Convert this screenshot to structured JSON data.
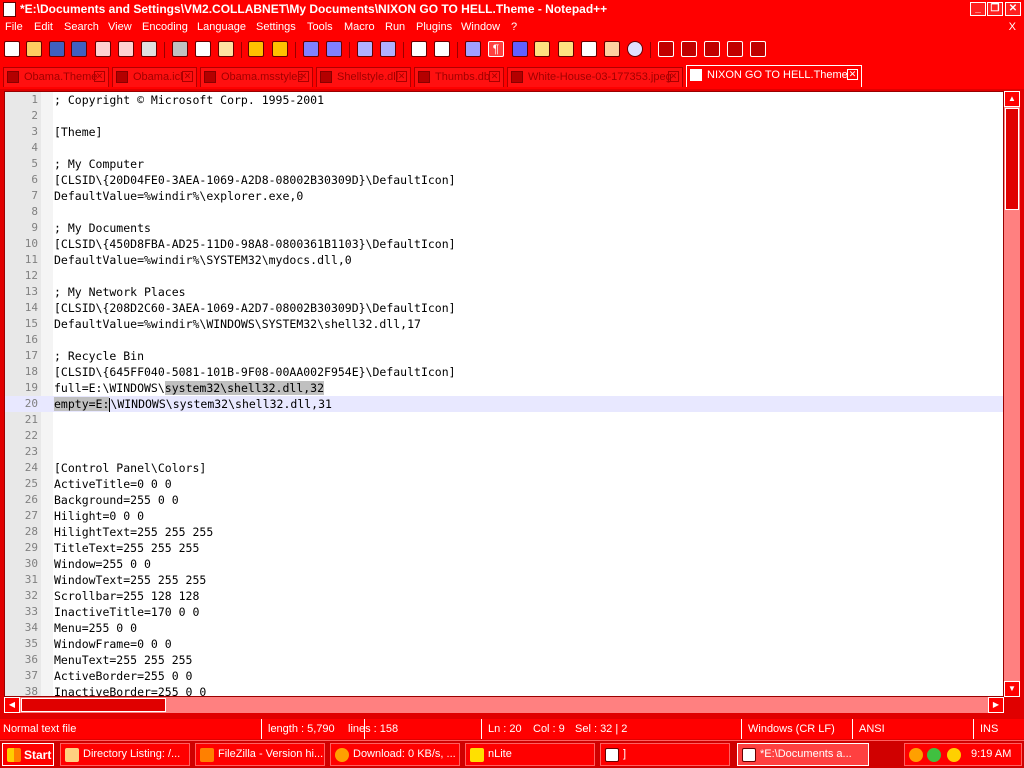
{
  "window": {
    "title": "*E:\\Documents and Settings\\VM2.COLLABNET\\My Documents\\NIXON GO TO HELL.Theme - Notepad++",
    "minimize": "_",
    "maximize": "❐",
    "close": "✕"
  },
  "menu": {
    "items": [
      "File",
      "Edit",
      "Search",
      "View",
      "Encoding",
      "Language",
      "Settings",
      "Tools",
      "Macro",
      "Run",
      "Plugins",
      "Window",
      "?"
    ],
    "close_doc": "X"
  },
  "toolbar": {
    "icons": [
      "new-icon",
      "open-icon",
      "save-icon",
      "save-all-icon",
      "close-icon",
      "close-all-icon",
      "print-icon",
      "cut-icon",
      "copy-icon",
      "paste-icon",
      "undo-icon",
      "redo-icon",
      "find-icon",
      "replace-icon",
      "zoom-in-icon",
      "zoom-out-icon",
      "sync-v-icon",
      "sync-h-icon",
      "wrap-icon",
      "all-chars-icon",
      "indent-guide-icon",
      "udl-icon",
      "doc-map-icon",
      "func-list-icon",
      "folder-icon",
      "monitor-icon",
      "record-icon",
      "stop-icon",
      "play-icon",
      "run-multi-icon",
      "save-macro-icon"
    ]
  },
  "tabs": [
    {
      "label": "Obama.Theme",
      "active": false
    },
    {
      "label": "Obama.icl",
      "active": false
    },
    {
      "label": "Obama.msstyles",
      "active": false
    },
    {
      "label": "Shellstyle.dll",
      "active": false
    },
    {
      "label": "Thumbs.db",
      "active": false
    },
    {
      "label": "White-House-03-177353.jpeg",
      "active": false
    },
    {
      "label": "NIXON GO TO HELL.Theme",
      "active": true
    }
  ],
  "editor": {
    "current_line": 20,
    "lines": [
      "; Copyright © Microsoft Corp. 1995-2001",
      "",
      "[Theme]",
      "",
      "; My Computer",
      "[CLSID\\{20D04FE0-3AEA-1069-A2D8-08002B30309D}\\DefaultIcon]",
      "DefaultValue=%windir%\\explorer.exe,0",
      "",
      "; My Documents",
      "[CLSID\\{450D8FBA-AD25-11D0-98A8-0800361B1103}\\DefaultIcon]",
      "DefaultValue=%windir%\\SYSTEM32\\mydocs.dll,0",
      "",
      "; My Network Places",
      "[CLSID\\{208D2C60-3AEA-1069-A2D7-08002B30309D}\\DefaultIcon]",
      "DefaultValue=%windir%\\WINDOWS\\SYSTEM32\\shell32.dll,17",
      "",
      "; Recycle Bin",
      "[CLSID\\{645FF040-5081-101B-9F08-00AA002F954E}\\DefaultIcon]",
      "full=E:\\WINDOWS\\system32\\shell32.dll,32",
      "empty=E:\\WINDOWS\\system32\\shell32.dll,31",
      "",
      "",
      "",
      "[Control Panel\\Colors]",
      "ActiveTitle=0 0 0",
      "Background=255 0 0",
      "Hilight=0 0 0",
      "HilightText=255 255 255",
      "TitleText=255 255 255",
      "Window=255 0 0",
      "WindowText=255 255 255",
      "Scrollbar=255 128 128",
      "InactiveTitle=170 0 0",
      "Menu=255 0 0",
      "WindowFrame=0 0 0",
      "MenuText=255 255 255",
      "ActiveBorder=255 0 0",
      "InactiveBorder=255 0 0"
    ],
    "line_numbers": [
      "1",
      "2",
      "3",
      "4",
      "5",
      "6",
      "7",
      "8",
      "9",
      "10",
      "11",
      "12",
      "13",
      "14",
      "15",
      "16",
      "17",
      "18",
      "19",
      "20",
      "21",
      "22",
      "23",
      "24",
      "25",
      "26",
      "27",
      "28",
      "29",
      "30",
      "31",
      "32",
      "33",
      "34",
      "35",
      "36",
      "37",
      "38"
    ]
  },
  "statusbar": {
    "type": "Normal text file",
    "length": "length : 5,790",
    "lines": "lines : 158",
    "ln": "Ln : 20",
    "col": "Col : 9",
    "sel": "Sel : 32 | 2",
    "eol": "Windows (CR LF)",
    "encoding": "ANSI",
    "mode": "INS"
  },
  "taskbar": {
    "start": "Start",
    "tasks": [
      {
        "label": "Directory Listing: /...",
        "icon": "folder-icon",
        "active": false
      },
      {
        "label": "FileZilla - Version hi...",
        "icon": "filezilla-icon",
        "active": false
      },
      {
        "label": "Download: 0 KB/s, ...",
        "icon": "download-icon",
        "active": false
      },
      {
        "label": "nLite",
        "icon": "nlite-icon",
        "active": false
      },
      {
        "label": "]",
        "icon": "window-icon",
        "active": false
      },
      {
        "label": "*E:\\Documents a...",
        "icon": "notepadpp-icon",
        "active": true
      }
    ],
    "clock": "9:19 AM"
  },
  "colors": {
    "chrome": "#ff0000",
    "selection": "#c0c0c0",
    "current_line": "#e8e8ff"
  }
}
